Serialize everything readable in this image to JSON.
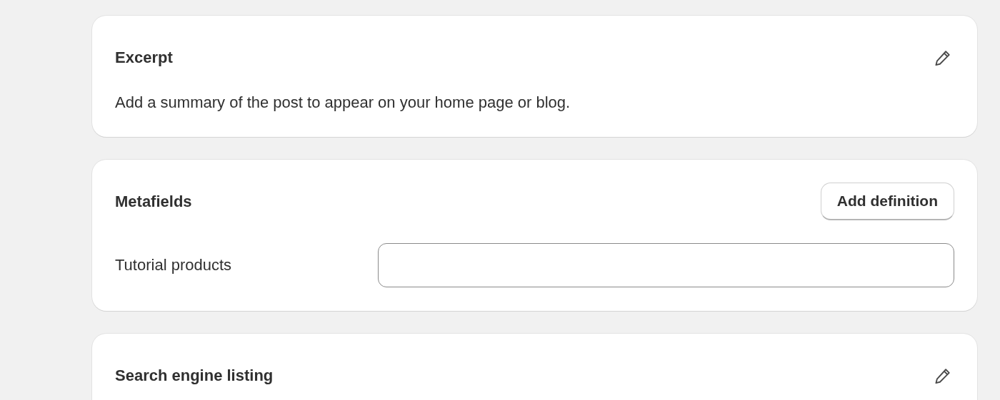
{
  "cards": [
    {
      "kind": "text",
      "title": "Excerpt",
      "description": "Add a summary of the post to appear on your home page or blog.",
      "editable": true
    },
    {
      "kind": "metafields",
      "title": "Metafields",
      "action": "Add definition",
      "fields": [
        {
          "label": "Tutorial products"
        }
      ]
    },
    {
      "kind": "text",
      "title": "Search engine listing",
      "editable": true
    }
  ]
}
